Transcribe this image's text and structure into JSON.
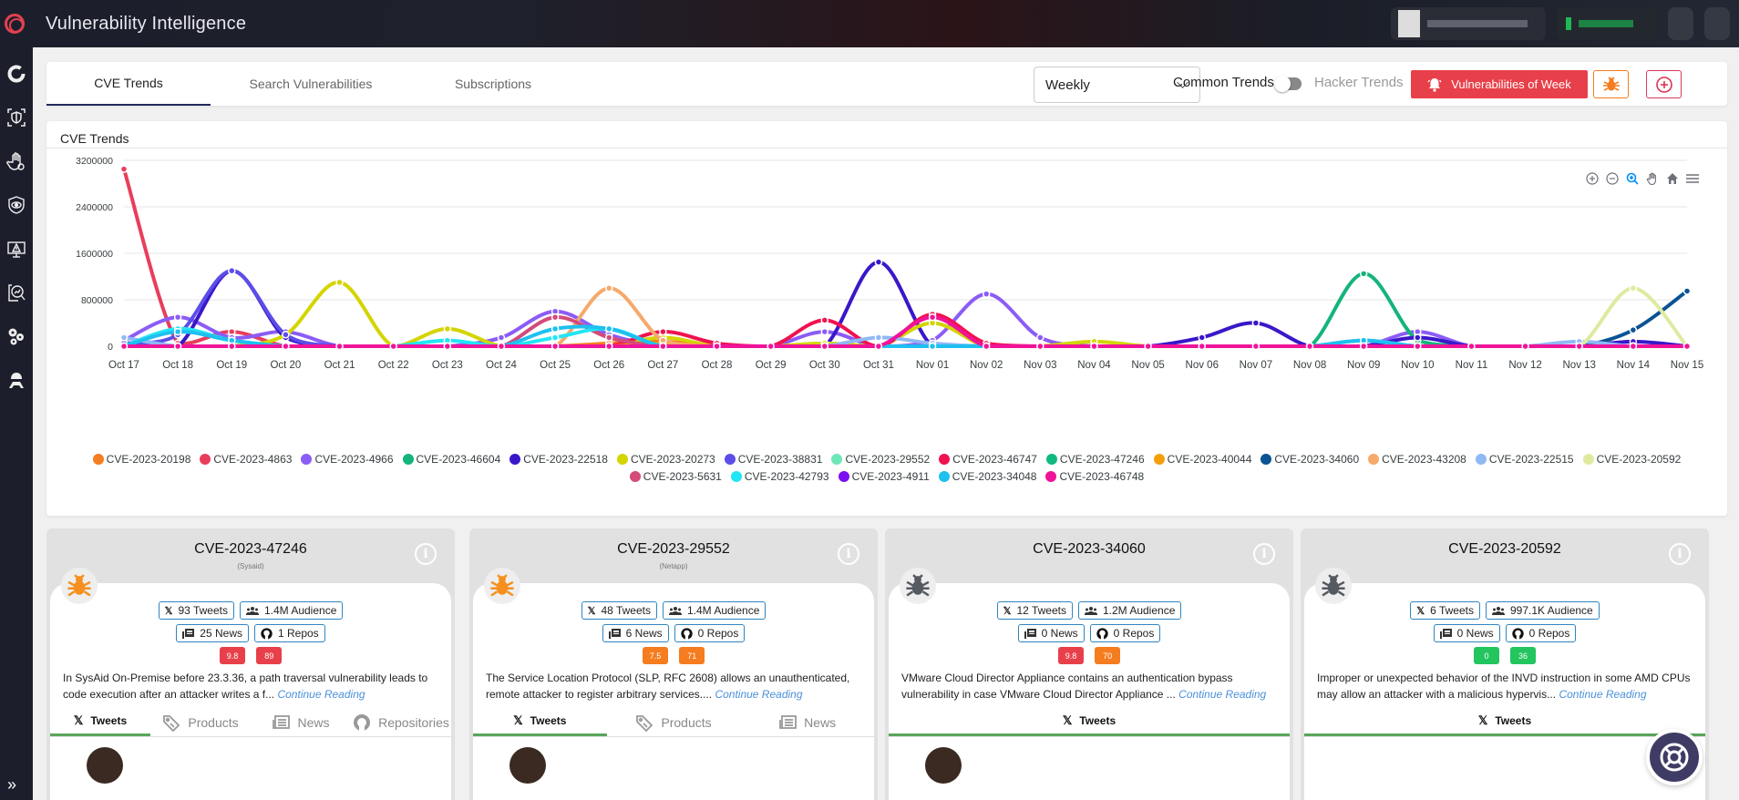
{
  "header": {
    "app_title": "Vulnerability Intelligence"
  },
  "sidebar": {
    "items": [
      {
        "name": "dashboard-icon"
      },
      {
        "name": "shield-scan-icon"
      },
      {
        "name": "hand-stop-icon"
      },
      {
        "name": "eye-shield-icon"
      },
      {
        "name": "alert-monitor-icon"
      },
      {
        "name": "report-analytics-icon"
      },
      {
        "name": "settings-gears-icon"
      },
      {
        "name": "hacker-icon"
      }
    ],
    "expand_label": "»"
  },
  "tabs": {
    "items": [
      {
        "label": "CVE Trends",
        "active": true
      },
      {
        "label": "Search Vulnerabilities",
        "active": false
      },
      {
        "label": "Subscriptions",
        "active": false
      }
    ],
    "period_select": "Weekly",
    "common_trends_label": "Common Trends",
    "hacker_trends_label": "Hacker Trends",
    "vulns_of_week_label": "Vulnerabilities of Week"
  },
  "colors": {
    "accent_red": "#e8404a",
    "orange": "#f57c1f",
    "green": "#22c55e",
    "tab_underline": "#5aa55a",
    "chip_border": "#2e86c1"
  },
  "chart": {
    "title": "CVE Trends"
  },
  "chart_data": {
    "type": "line",
    "title": "CVE Trends",
    "xlabel": "",
    "ylabel": "",
    "ylim": [
      0,
      3200000
    ],
    "yticks": [
      "0",
      "800000",
      "1600000",
      "2400000",
      "3200000"
    ],
    "grid": true,
    "legend_position": "bottom",
    "x": [
      "Oct 17",
      "Oct 18",
      "Oct 19",
      "Oct 20",
      "Oct 21",
      "Oct 22",
      "Oct 23",
      "Oct 24",
      "Oct 25",
      "Oct 26",
      "Oct 27",
      "Oct 28",
      "Oct 29",
      "Oct 30",
      "Oct 31",
      "Nov 01",
      "Nov 02",
      "Nov 03",
      "Nov 04",
      "Nov 05",
      "Nov 06",
      "Nov 07",
      "Nov 08",
      "Nov 09",
      "Nov 10",
      "Nov 11",
      "Nov 12",
      "Nov 13",
      "Nov 14",
      "Nov 15"
    ],
    "series": [
      {
        "name": "CVE-2023-20198",
        "color": "#f57c1f",
        "values": [
          0,
          0,
          0,
          0,
          0,
          0,
          0,
          0,
          0,
          50000,
          80000,
          0,
          0,
          0,
          0,
          0,
          0,
          0,
          0,
          0,
          0,
          0,
          0,
          0,
          0,
          0,
          0,
          0,
          0,
          0
        ]
      },
      {
        "name": "CVE-2023-4863",
        "color": "#e83e5c",
        "values": [
          3050000,
          50000,
          250000,
          0,
          0,
          0,
          0,
          0,
          0,
          0,
          0,
          0,
          0,
          0,
          0,
          0,
          0,
          0,
          0,
          0,
          0,
          0,
          0,
          0,
          0,
          0,
          0,
          0,
          0,
          0
        ]
      },
      {
        "name": "CVE-2023-4966",
        "color": "#8b5cf6",
        "values": [
          100000,
          500000,
          150000,
          250000,
          0,
          0,
          0,
          150000,
          600000,
          200000,
          0,
          0,
          0,
          250000,
          0,
          100000,
          900000,
          150000,
          0,
          0,
          0,
          0,
          0,
          0,
          250000,
          0,
          0,
          0,
          0,
          0
        ]
      },
      {
        "name": "CVE-2023-46604",
        "color": "#14b47a",
        "values": [
          0,
          0,
          0,
          0,
          0,
          0,
          0,
          0,
          0,
          0,
          0,
          0,
          0,
          0,
          0,
          0,
          0,
          0,
          0,
          0,
          0,
          0,
          0,
          1250000,
          100000,
          0,
          0,
          0,
          0,
          0
        ]
      },
      {
        "name": "CVE-2023-22518",
        "color": "#3a17c9",
        "values": [
          0,
          0,
          1300000,
          150000,
          0,
          0,
          0,
          0,
          0,
          0,
          0,
          0,
          0,
          0,
          1450000,
          0,
          0,
          0,
          0,
          0,
          150000,
          400000,
          0,
          0,
          150000,
          0,
          0,
          0,
          80000,
          0
        ]
      },
      {
        "name": "CVE-2023-20273",
        "color": "#d4d400",
        "values": [
          0,
          0,
          0,
          200000,
          1100000,
          0,
          300000,
          0,
          0,
          0,
          150000,
          0,
          0,
          50000,
          0,
          400000,
          0,
          0,
          80000,
          0,
          0,
          0,
          0,
          0,
          0,
          0,
          0,
          0,
          0,
          0
        ]
      },
      {
        "name": "CVE-2023-38831",
        "color": "#5b4ee8",
        "values": [
          50000,
          200000,
          1300000,
          200000,
          0,
          0,
          0,
          0,
          0,
          0,
          0,
          0,
          0,
          0,
          0,
          0,
          0,
          0,
          0,
          0,
          0,
          0,
          0,
          0,
          0,
          0,
          0,
          0,
          0,
          0
        ]
      },
      {
        "name": "CVE-2023-29552",
        "color": "#6ee7b7",
        "values": [
          0,
          0,
          0,
          0,
          0,
          0,
          0,
          0,
          0,
          0,
          0,
          0,
          0,
          0,
          0,
          0,
          0,
          0,
          0,
          0,
          0,
          0,
          0,
          100000,
          0,
          0,
          0,
          0,
          0,
          0
        ]
      },
      {
        "name": "CVE-2023-46747",
        "color": "#f0124f",
        "values": [
          0,
          0,
          0,
          0,
          0,
          0,
          0,
          0,
          0,
          0,
          250000,
          50000,
          0,
          450000,
          0,
          550000,
          50000,
          0,
          0,
          0,
          0,
          0,
          0,
          0,
          0,
          0,
          0,
          0,
          0,
          0
        ]
      },
      {
        "name": "CVE-2023-47246",
        "color": "#10b981",
        "values": [
          0,
          0,
          0,
          0,
          0,
          0,
          0,
          0,
          0,
          0,
          0,
          0,
          0,
          0,
          0,
          0,
          0,
          0,
          0,
          0,
          0,
          0,
          0,
          0,
          0,
          0,
          0,
          0,
          0,
          0
        ]
      },
      {
        "name": "CVE-2023-40044",
        "color": "#f59e0b",
        "values": [
          0,
          0,
          0,
          0,
          0,
          0,
          0,
          0,
          0,
          0,
          50000,
          0,
          0,
          0,
          0,
          0,
          0,
          0,
          0,
          0,
          0,
          0,
          0,
          0,
          0,
          0,
          0,
          0,
          0,
          0
        ]
      },
      {
        "name": "CVE-2023-34060",
        "color": "#0b5394",
        "values": [
          0,
          0,
          0,
          0,
          0,
          0,
          0,
          0,
          0,
          0,
          0,
          0,
          0,
          0,
          0,
          0,
          0,
          0,
          0,
          0,
          0,
          0,
          0,
          0,
          0,
          0,
          0,
          0,
          280000,
          950000
        ]
      },
      {
        "name": "CVE-2023-43208",
        "color": "#f6a96b",
        "values": [
          0,
          0,
          0,
          0,
          0,
          0,
          0,
          0,
          0,
          1000000,
          100000,
          0,
          0,
          0,
          0,
          0,
          0,
          0,
          0,
          0,
          0,
          0,
          0,
          0,
          0,
          0,
          0,
          0,
          0,
          0
        ]
      },
      {
        "name": "CVE-2023-22515",
        "color": "#8fb8f5",
        "values": [
          150000,
          0,
          0,
          0,
          0,
          0,
          0,
          0,
          0,
          0,
          0,
          0,
          0,
          0,
          150000,
          50000,
          0,
          0,
          0,
          0,
          0,
          0,
          0,
          100000,
          0,
          0,
          0,
          80000,
          0,
          0
        ]
      },
      {
        "name": "CVE-2023-20592",
        "color": "#dfeaa0",
        "values": [
          0,
          0,
          0,
          0,
          0,
          0,
          0,
          0,
          0,
          0,
          0,
          0,
          0,
          0,
          0,
          0,
          0,
          0,
          0,
          0,
          0,
          0,
          0,
          0,
          0,
          0,
          0,
          0,
          1000000,
          0
        ]
      },
      {
        "name": "CVE-2023-5631",
        "color": "#d44a7a",
        "values": [
          0,
          0,
          0,
          0,
          0,
          0,
          0,
          0,
          500000,
          150000,
          0,
          0,
          0,
          0,
          0,
          0,
          0,
          0,
          0,
          0,
          0,
          0,
          0,
          0,
          0,
          0,
          0,
          0,
          0,
          0
        ]
      },
      {
        "name": "CVE-2023-42793",
        "color": "#22e5f5",
        "values": [
          0,
          300000,
          100000,
          0,
          0,
          0,
          100000,
          0,
          150000,
          300000,
          0,
          0,
          0,
          0,
          0,
          0,
          0,
          0,
          0,
          0,
          0,
          0,
          0,
          0,
          0,
          0,
          0,
          0,
          0,
          0
        ]
      },
      {
        "name": "CVE-2023-4911",
        "color": "#7c10f0",
        "values": [
          0,
          0,
          0,
          0,
          0,
          0,
          0,
          0,
          0,
          0,
          0,
          0,
          0,
          0,
          0,
          0,
          0,
          0,
          0,
          0,
          0,
          0,
          0,
          0,
          0,
          0,
          0,
          0,
          0,
          0
        ]
      },
      {
        "name": "CVE-2023-34048",
        "color": "#1ec0f0",
        "values": [
          0,
          250000,
          100000,
          0,
          0,
          0,
          0,
          0,
          300000,
          300000,
          0,
          0,
          0,
          0,
          0,
          0,
          0,
          0,
          0,
          0,
          0,
          0,
          0,
          100000,
          0,
          0,
          0,
          0,
          0,
          0
        ]
      },
      {
        "name": "CVE-2023-46748",
        "color": "#f0139a",
        "values": [
          0,
          0,
          0,
          0,
          0,
          0,
          0,
          0,
          0,
          0,
          0,
          0,
          0,
          0,
          0,
          500000,
          0,
          0,
          0,
          0,
          0,
          0,
          0,
          0,
          0,
          0,
          0,
          0,
          0,
          0
        ]
      }
    ]
  },
  "cards": [
    {
      "cve": "CVE-2023-47246",
      "vendor": "(Sysaid)",
      "bug_color": "#f5901e",
      "tweets": "93 Tweets",
      "audience": "1.4M Audience",
      "news": "25 News",
      "repos": "1 Repos",
      "scores": [
        {
          "value": "9.8",
          "color": "#e8404a"
        },
        {
          "value": "89",
          "color": "#e8404a"
        }
      ],
      "description": "In SysAid On-Premise before 23.3.36, a path traversal vulnerability leads to code execution after an attacker writes a f...",
      "continue": "Continue Reading",
      "tabs": [
        "Tweets",
        "Products",
        "News",
        "Repositories"
      ]
    },
    {
      "cve": "CVE-2023-29552",
      "vendor": "(Netapp)",
      "bug_color": "#f5901e",
      "tweets": "48 Tweets",
      "audience": "1.4M Audience",
      "news": "6 News",
      "repos": "0 Repos",
      "scores": [
        {
          "value": "7.5",
          "color": "#f57c1f"
        },
        {
          "value": "71",
          "color": "#f57c1f"
        }
      ],
      "description": "The Service Location Protocol (SLP, RFC 2608) allows an unauthenticated, remote attacker to register arbitrary services....",
      "continue": "Continue Reading",
      "tabs": [
        "Tweets",
        "Products",
        "News"
      ]
    },
    {
      "cve": "CVE-2023-34060",
      "vendor": "",
      "bug_color": "#555a60",
      "tweets": "12 Tweets",
      "audience": "1.2M Audience",
      "news": "0 News",
      "repos": "0 Repos",
      "scores": [
        {
          "value": "9.8",
          "color": "#e8404a"
        },
        {
          "value": "70",
          "color": "#f57c1f"
        }
      ],
      "description": "VMware Cloud Director Appliance contains an authentication bypass vulnerability in case VMware Cloud Director Appliance ...",
      "continue": "Continue Reading",
      "tabs": [
        "Tweets"
      ]
    },
    {
      "cve": "CVE-2023-20592",
      "vendor": "",
      "bug_color": "#555a60",
      "tweets": "6 Tweets",
      "audience": "997.1K Audience",
      "news": "0 News",
      "repos": "0 Repos",
      "scores": [
        {
          "value": "0",
          "color": "#22c55e"
        },
        {
          "value": "36",
          "color": "#22c55e"
        }
      ],
      "description": "Improper or unexpected behavior of the INVD instruction in some AMD CPUs may allow an attacker with a malicious hypervis...",
      "continue": "Continue Reading",
      "tabs": [
        "Tweets"
      ]
    }
  ]
}
